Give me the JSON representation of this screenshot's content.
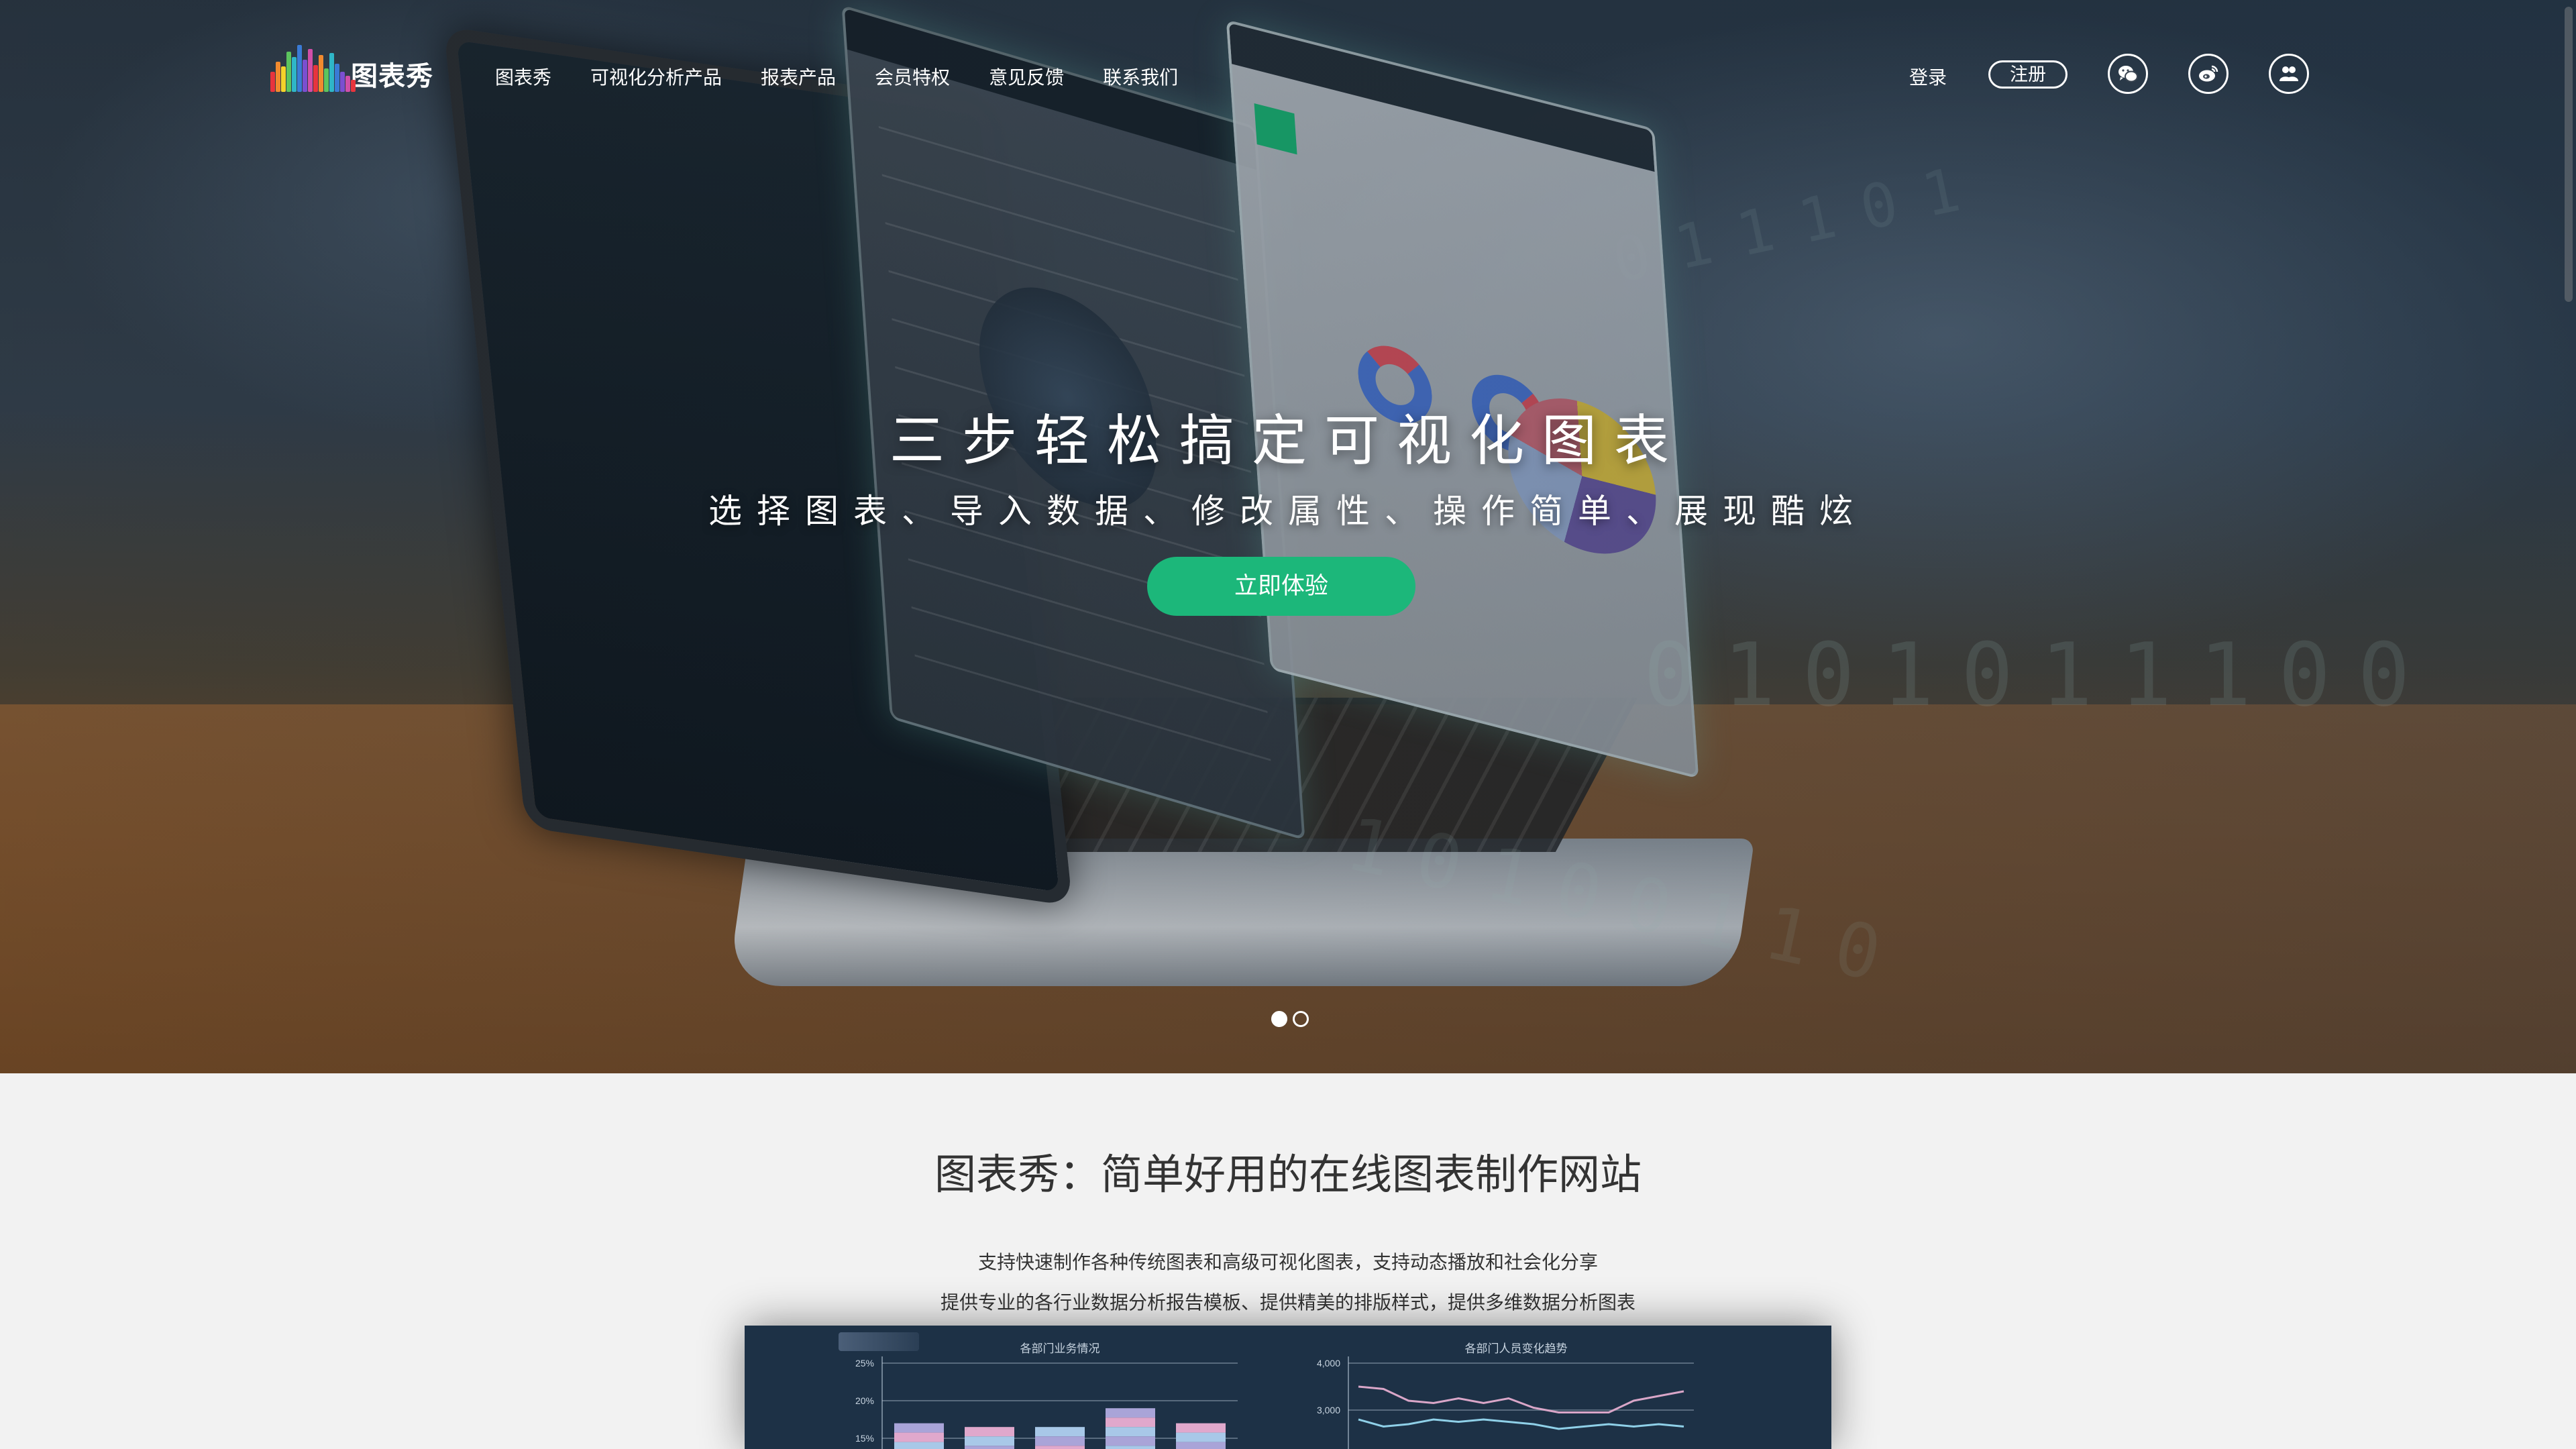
{
  "nav": {
    "logo_text": "图表秀",
    "links": [
      "图表秀",
      "可视化分析产品",
      "报表产品",
      "会员特权",
      "意见反馈",
      "联系我们"
    ],
    "login_label": "登录",
    "register_label": "注册",
    "social_icons": [
      "wechat-icon",
      "weibo-icon",
      "group-icon"
    ]
  },
  "hero": {
    "title": "三步轻松搞定可视化图表",
    "subtitle": "选择图表、导入数据、修改属性、操作简单、展现酷炫",
    "cta_label": "立即体验",
    "carousel": {
      "slides": 2,
      "active": 0
    },
    "accent_color": "#1cb77a"
  },
  "intro": {
    "title": "图表秀：简单好用的在线图表制作网站",
    "line1": "支持快速制作各种传统图表和高级可视化图表，支持动态播放和社会化分享",
    "line2": "提供专业的各行业数据分析报告模板、提供精美的排版样式，提供多维数据分析图表"
  },
  "chart_data": [
    {
      "type": "bar",
      "title": "各部门业务情况",
      "y_ticks": [
        "25%",
        "20%",
        "15%"
      ],
      "ylim": [
        10,
        25
      ],
      "categories": [
        "",
        "",
        "",
        "",
        ""
      ],
      "series": [
        {
          "values": [
            17,
            16.5,
            16.5,
            19,
            17
          ]
        }
      ],
      "colors": [
        "#a9a4d8",
        "#e0a8cc",
        "#a8c8e8"
      ],
      "grid": true
    },
    {
      "type": "line",
      "title": "各部门人员变化趋势",
      "y_ticks": [
        "4,000",
        "3,000"
      ],
      "ylim": [
        2400,
        4100
      ],
      "series": [
        {
          "values": [
            3500,
            3450,
            3200,
            3150,
            3250,
            3150,
            3250,
            3050,
            2950,
            2950,
            2950,
            3200,
            3300,
            3400
          ],
          "color": "#d9a6c8"
        },
        {
          "values": [
            2800,
            2650,
            2700,
            2800,
            2750,
            2800,
            2750,
            2700,
            2600,
            2650,
            2700,
            2650,
            2700,
            2650
          ],
          "color": "#8fd0e8"
        }
      ],
      "grid": true
    }
  ]
}
